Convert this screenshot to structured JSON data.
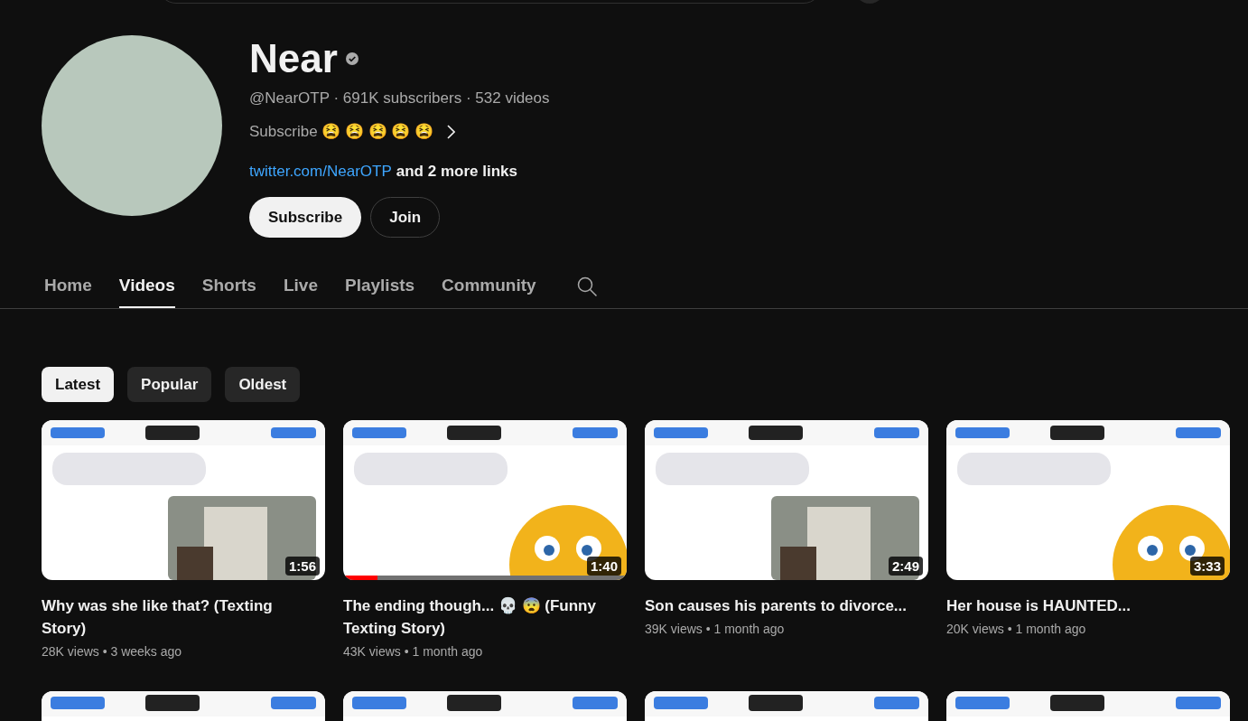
{
  "channel": {
    "name": "Near",
    "verified": true,
    "meta": "@NearOTP · 691K subscribers · 532 videos",
    "description": "Subscribe 😫 😫 😫 😫 😫",
    "link": "twitter.com/NearOTP",
    "more_links": "and 2 more links"
  },
  "buttons": [
    {
      "label": "Subscribe",
      "kind": "primary"
    },
    {
      "label": "Join",
      "kind": "outline"
    }
  ],
  "tabs": [
    {
      "label": "Home",
      "selected": false
    },
    {
      "label": "Videos",
      "selected": true
    },
    {
      "label": "Shorts",
      "selected": false
    },
    {
      "label": "Live",
      "selected": false
    },
    {
      "label": "Playlists",
      "selected": false
    },
    {
      "label": "Community",
      "selected": false
    }
  ],
  "chips": [
    {
      "label": "Latest",
      "selected": true
    },
    {
      "label": "Popular",
      "selected": false
    },
    {
      "label": "Oldest",
      "selected": false
    }
  ],
  "videos": [
    {
      "title": "Why was she like that? (Texting Story)",
      "meta": "28K views • 3 weeks ago",
      "duration": "1:56"
    },
    {
      "title": "The ending though... 💀 😨 (Funny Texting Story)",
      "meta": "43K views • 1 month ago",
      "duration": "1:40",
      "kind": "emoji",
      "level": 0.12
    },
    {
      "title": "Son causes his parents to divorce...",
      "meta": "39K views • 1 month ago",
      "duration": "2:49"
    },
    {
      "title": "Her house is HAUNTED...",
      "meta": "20K views • 1 month ago",
      "duration": "3:33",
      "kind": "emoji"
    }
  ]
}
